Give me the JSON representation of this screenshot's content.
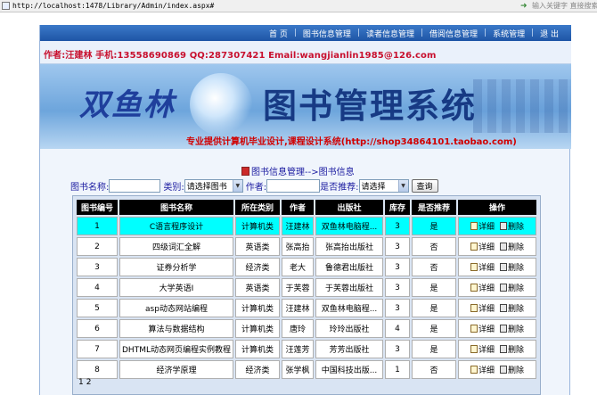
{
  "browser": {
    "url": "http://localhost:1478/Library/Admin/index.aspx#",
    "search_hint": "输入关键字 直接搜索"
  },
  "nav": {
    "items": [
      "首 页",
      "图书信息管理",
      "读者信息管理",
      "借阅信息管理",
      "系统管理",
      "退 出"
    ]
  },
  "info": {
    "author_line": "作者:汪建林  手机:13558690869 QQ:287307421 Email:wangjianlin1985@126.com"
  },
  "banner": {
    "logo": "双鱼林",
    "system_name": "图书管理系统",
    "slogan": "专业提供计算机毕业设计,课程设计系统(http://shop34864101.taobao.com)"
  },
  "breadcrumb": "图书信息管理-->图书信息",
  "search": {
    "title_label": "图书名称:",
    "title_value": "",
    "category_label": "类别:",
    "category_selected": "请选择图书",
    "author_label": "作者:",
    "author_value": "",
    "recommend_label": "是否推荐:",
    "recommend_selected": "请选择",
    "query_button": "查询"
  },
  "table": {
    "headers": [
      "图书编号",
      "图书名称",
      "所在类别",
      "作者",
      "出版社",
      "库存",
      "是否推荐",
      "操作"
    ],
    "detail_label": "详细",
    "delete_label": "删除",
    "rows": [
      {
        "id": "1",
        "title": "C语言程序设计",
        "category": "计算机类",
        "author": "汪建林",
        "publisher": "双鱼林电脑程...",
        "stock": "3",
        "recommend": "是"
      },
      {
        "id": "2",
        "title": "四级词汇全解",
        "category": "英语类",
        "author": "张高抬",
        "publisher": "张高抬出版社",
        "stock": "3",
        "recommend": "否"
      },
      {
        "id": "3",
        "title": "证券分析学",
        "category": "经济类",
        "author": "老大",
        "publisher": "鲁德君出版社",
        "stock": "3",
        "recommend": "否"
      },
      {
        "id": "4",
        "title": "大学英语I",
        "category": "英语类",
        "author": "于芙蓉",
        "publisher": "于芙蓉出版社",
        "stock": "3",
        "recommend": "是"
      },
      {
        "id": "5",
        "title": "asp动态网站编程",
        "category": "计算机类",
        "author": "汪建林",
        "publisher": "双鱼林电脑程...",
        "stock": "3",
        "recommend": "是"
      },
      {
        "id": "6",
        "title": "算法与数据结构",
        "category": "计算机类",
        "author": "唐玲",
        "publisher": "玲玲出版社",
        "stock": "4",
        "recommend": "是"
      },
      {
        "id": "7",
        "title": "DHTML动态网页编程实例教程",
        "category": "计算机类",
        "author": "汪莲芳",
        "publisher": "芳芳出版社",
        "stock": "3",
        "recommend": "是"
      },
      {
        "id": "8",
        "title": "经济学原理",
        "category": "经济类",
        "author": "张学枫",
        "publisher": "中国科技出版...",
        "stock": "1",
        "recommend": "否"
      }
    ]
  },
  "pager": [
    "1",
    "2"
  ]
}
